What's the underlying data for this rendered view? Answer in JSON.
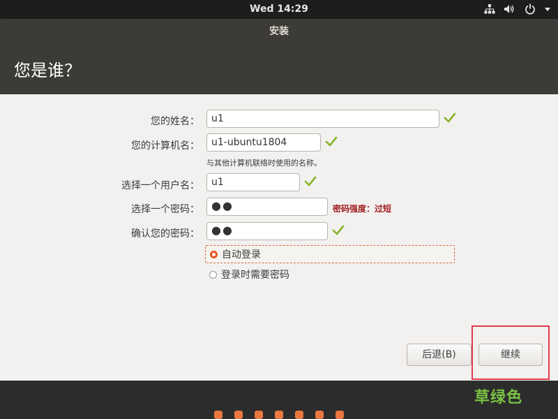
{
  "topbar": {
    "clock": "Wed 14:29",
    "tray_icons": [
      "network-icon",
      "volume-icon",
      "power-icon",
      "chevron-down-icon"
    ]
  },
  "window": {
    "title": "安装",
    "heading": "您是谁？"
  },
  "form": {
    "name_label": "您的姓名：",
    "name_value": "u1",
    "computer_label": "您的计算机名：",
    "computer_value": "u1-ubuntu1804",
    "computer_hint": "与其他计算机联络时使用的名称。",
    "username_label": "选择一个用户名：",
    "username_value": "u1",
    "password_label": "选择一个密码：",
    "password_value": "●●",
    "password_strength": "密码强度：过短",
    "confirm_label": "确认您的密码：",
    "confirm_value": "●●",
    "auto_login_label": "自动登录",
    "require_password_label": "登录时需要密码",
    "auto_login_selected": true
  },
  "buttons": {
    "back_label": "后退(B)",
    "continue_label": "继续"
  },
  "annotation": {
    "text": "草绿色",
    "color": "#7ac143"
  },
  "progress": {
    "steps_total": 7,
    "accent_color": "#e9773f"
  },
  "colors": {
    "accent": "#e95420",
    "titlebar": "#3d3b37",
    "check": "#87b325",
    "error": "#a01d1d"
  }
}
